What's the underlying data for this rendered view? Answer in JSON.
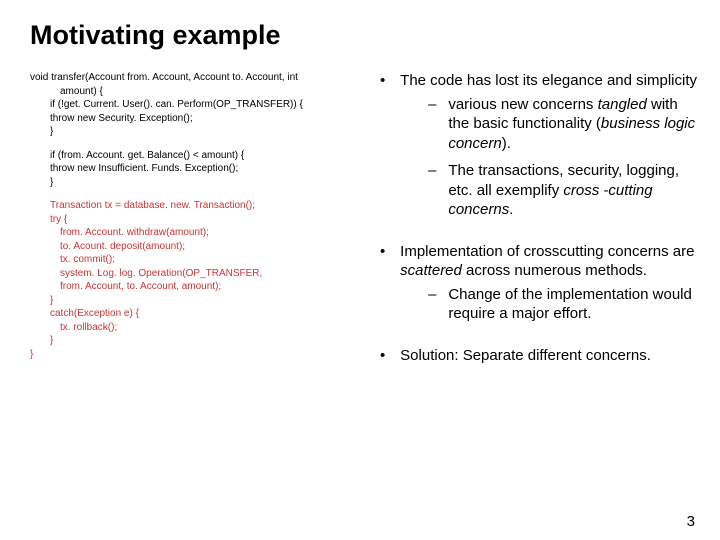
{
  "title": "Motivating example",
  "code": {
    "line1": "void transfer(Account from. Account, Account to. Account, int",
    "line2": "amount) {",
    "line3": "if (!get. Current. User(). can. Perform(OP_TRANSFER)) {",
    "line4": "throw new Security. Exception();",
    "line5": "}",
    "line6": "if (from. Account. get. Balance() < amount) {",
    "line7": "throw new Insufficient. Funds. Exception();",
    "line8": "}",
    "line9": "Transaction tx = database. new. Transaction();",
    "line10": "try {",
    "line11": "from. Account. withdraw(amount);",
    "line12": "to. Acount. deposit(amount);",
    "line13": "tx. commit();",
    "line14": "system. Log. log. Operation(OP_TRANSFER,",
    "line15": "from. Account, to. Account, amount);",
    "line16": "}",
    "line17": "catch(Exception e) {",
    "line18": "tx. rollback();",
    "line19": "}",
    "line20": "}"
  },
  "bullets": {
    "b1": "The code has lost its elegance and simplicity",
    "b1s1a": "various new concerns ",
    "b1s1b": "tangled ",
    "b1s1c": "with the basic functionality (",
    "b1s1d": "business logic concern",
    "b1s1e": ").",
    "b1s2a": "The transactions, security, logging, etc. all exemplify ",
    "b1s2b": "cross -cutting concerns",
    "b1s2c": ".",
    "b2a": "Implementation of crosscutting concerns are ",
    "b2b": "scattered ",
    "b2c": "across numerous methods.",
    "b2s1": "Change of the implementation would require a major effort.",
    "b3": "Solution: Separate different concerns."
  },
  "pageNumber": "3"
}
